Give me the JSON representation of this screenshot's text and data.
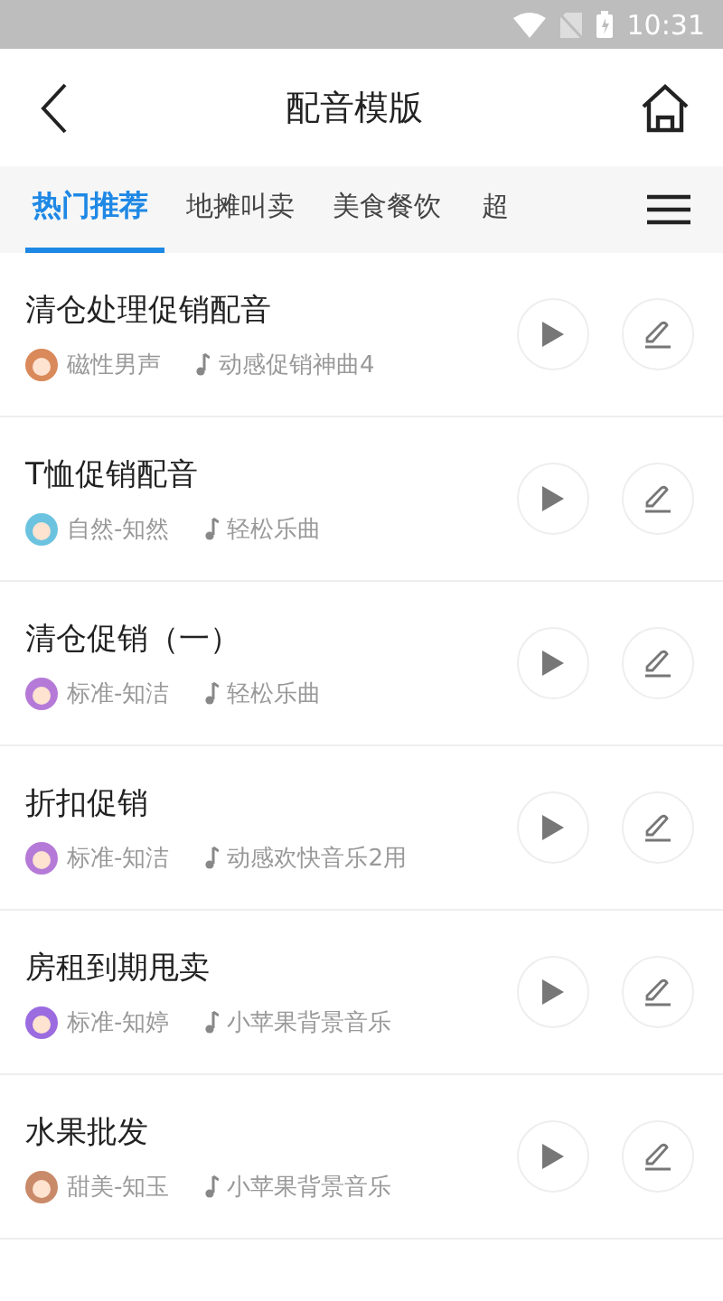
{
  "status_bar": {
    "time": "10:31"
  },
  "header": {
    "title": "配音模版"
  },
  "tabs": [
    {
      "label": "热门推荐",
      "selected": true
    },
    {
      "label": "地摊叫卖",
      "selected": false
    },
    {
      "label": "美食餐饮",
      "selected": false
    },
    {
      "label": "超",
      "selected": false
    }
  ],
  "templates": [
    {
      "title": "清仓处理促销配音",
      "voice": "磁性男声",
      "music": "动感促销神曲4",
      "color": "#d9895a"
    },
    {
      "title": "T恤促销配音",
      "voice": "自然-知然",
      "music": "轻松乐曲",
      "color": "#6cc3e0"
    },
    {
      "title": "清仓促销（一）",
      "voice": "标准-知洁",
      "music": "轻松乐曲",
      "color": "#b57ad8"
    },
    {
      "title": "折扣促销",
      "voice": "标准-知洁",
      "music": "动感欢快音乐2用",
      "color": "#b57ad8"
    },
    {
      "title": "房租到期甩卖",
      "voice": "标准-知婷",
      "music": "小苹果背景音乐",
      "color": "#9b6be0"
    },
    {
      "title": "水果批发",
      "voice": "甜美-知玉",
      "music": "小苹果背景音乐",
      "color": "#c98a6a"
    }
  ]
}
